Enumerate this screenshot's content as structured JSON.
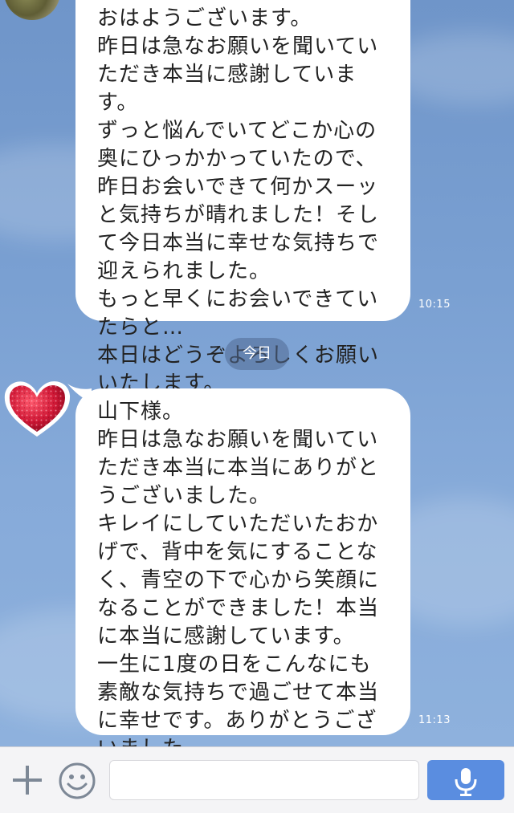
{
  "messages": [
    {
      "text": "おはようございます。\n昨日は急なお願いを聞いていただき本当に感謝しています。\nずっと悩んでいてどこか心の奥にひっかかっていたので、昨日お会いできて何かスーッと気持ちが晴れました！そして今日本当に幸せな気持ちで迎えられました。\nもっと早くにお会いできていたらと…\n本日はどうぞよろしくお願いいたします。",
      "time": "10:15"
    },
    {
      "text": "山下様。\n昨日は急なお願いを聞いていただき本当に本当にありがとうございました。\nキレイにしていただいたおかげで、背中を気にすることなく、青空の下で心から笑顔になることができました！本当に本当に感謝しています。\n一生に1度の日をこんなにも素敵な気持ちで過ごせて本当に幸せです。ありがとうございました。",
      "time": "11:13"
    }
  ],
  "date_separator": "今日",
  "input": {
    "placeholder": ""
  },
  "colors": {
    "background": "#7aa0d2",
    "bubble": "#ffffff",
    "mic_button": "#5a8de0",
    "heart": "#c8102e"
  },
  "icons": {
    "add": "plus-icon",
    "emoji": "smiley-icon",
    "voice": "microphone-icon"
  }
}
